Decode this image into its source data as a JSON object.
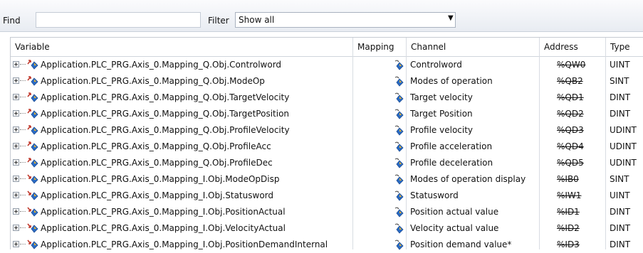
{
  "toolbar": {
    "find_label": "Find",
    "find_value": "",
    "filter_label": "Filter",
    "filter_value": "Show all"
  },
  "columns": {
    "variable": "Variable",
    "mapping": "Mapping",
    "channel": "Channel",
    "address": "Address",
    "type": "Type"
  },
  "rows": [
    {
      "variable": "Application.PLC_PRG.Axis_0.Mapping_Q.Obj.Controlword",
      "direction": "output",
      "channel": "Controlword",
      "address": "%QW0",
      "type": "UINT"
    },
    {
      "variable": "Application.PLC_PRG.Axis_0.Mapping_Q.Obj.ModeOp",
      "direction": "output",
      "channel": "Modes of operation",
      "address": "%QB2",
      "type": "SINT"
    },
    {
      "variable": "Application.PLC_PRG.Axis_0.Mapping_Q.Obj.TargetVelocity",
      "direction": "output",
      "channel": "Target velocity",
      "address": "%QD1",
      "type": "DINT"
    },
    {
      "variable": "Application.PLC_PRG.Axis_0.Mapping_Q.Obj.TargetPosition",
      "direction": "output",
      "channel": "Target Position",
      "address": "%QD2",
      "type": "DINT"
    },
    {
      "variable": "Application.PLC_PRG.Axis_0.Mapping_Q.Obj.ProfileVelocity",
      "direction": "output",
      "channel": "Profile velocity",
      "address": "%QD3",
      "type": "UDINT"
    },
    {
      "variable": "Application.PLC_PRG.Axis_0.Mapping_Q.Obj.ProfileAcc",
      "direction": "output",
      "channel": "Profile acceleration",
      "address": "%QD4",
      "type": "UDINT"
    },
    {
      "variable": "Application.PLC_PRG.Axis_0.Mapping_Q.Obj.ProfileDec",
      "direction": "output",
      "channel": "Profile deceleration",
      "address": "%QD5",
      "type": "UDINT"
    },
    {
      "variable": "Application.PLC_PRG.Axis_0.Mapping_I.Obj.ModeOpDisp",
      "direction": "input",
      "channel": "Modes of operation display",
      "address": "%IB0",
      "type": "SINT"
    },
    {
      "variable": "Application.PLC_PRG.Axis_0.Mapping_I.Obj.Statusword",
      "direction": "input",
      "channel": "Statusword",
      "address": "%IW1",
      "type": "UINT"
    },
    {
      "variable": "Application.PLC_PRG.Axis_0.Mapping_I.Obj.PositionActual",
      "direction": "input",
      "channel": "Position actual value",
      "address": "%ID1",
      "type": "DINT"
    },
    {
      "variable": "Application.PLC_PRG.Axis_0.Mapping_I.Obj.VelocityActual",
      "direction": "input",
      "channel": "Velocity actual value",
      "address": "%ID2",
      "type": "DINT"
    },
    {
      "variable": "Application.PLC_PRG.Axis_0.Mapping_I.Obj.PositionDemandInternal",
      "direction": "input",
      "channel": "Position demand value*",
      "address": "%ID3",
      "type": "DINT"
    }
  ],
  "icons": {
    "variable_icon": "io-variable-icon",
    "mapping_icon": "existing-variable-map-icon"
  },
  "colors": {
    "output_arrow": "#c0392b",
    "input_arrow": "#c0392b",
    "variable_blue": "#2b6cc4"
  }
}
